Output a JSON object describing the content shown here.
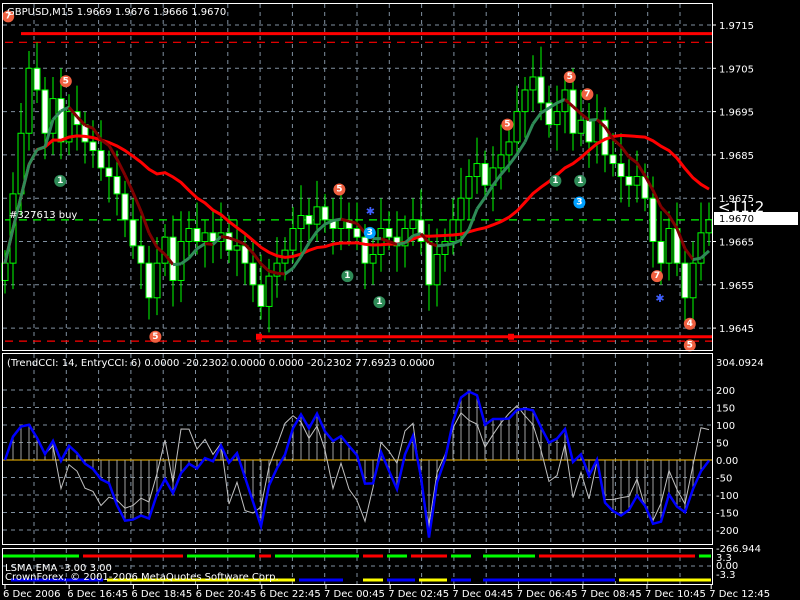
{
  "header": {
    "symbol_info": "GBPUSD,M15  1.9669 1.9676 1.9666 1.9670"
  },
  "main_axis": {
    "ticks": [
      "1.9715",
      "1.9705",
      "1.9695",
      "1.9685",
      "1.9675",
      "1.9665",
      "1.9655",
      "1.9645"
    ],
    "current_price": "1.9670",
    "timer_label": "<11:2"
  },
  "order_label": "#327613 buy",
  "cci_pane": {
    "title": "(TrendCCI: 14, EntryCCI: 6)  0.0000 -20.2302 0.0000 0.0000 -20.2302 77.6923 0.0000",
    "ticks": [
      "304.0924",
      "200",
      "150",
      "100",
      "50",
      "0.00",
      "-50",
      "-100",
      "-150",
      "-200",
      "-266.944"
    ],
    "trend_color": "#0000ff",
    "entry_color": "#c0c0c0"
  },
  "lsma_pane": {
    "title": "LSMA EMA -3.00 3.00",
    "copyright": "CrownForex, © 2001-2006 MetaQuotes Software Corp.",
    "ticks": [
      "3.3",
      "0.00",
      "-3.3"
    ],
    "top_segments": [
      [
        0,
        9,
        "#00ff00"
      ],
      [
        10,
        22,
        "#ff0000"
      ],
      [
        23,
        31,
        "#00ff00"
      ],
      [
        32,
        33,
        "#ff0000"
      ],
      [
        34,
        44,
        "#00ff00"
      ],
      [
        45,
        47,
        "#ff0000"
      ],
      [
        48,
        50,
        "#00ff00"
      ],
      [
        51,
        55,
        "#ff0000"
      ],
      [
        56,
        58,
        "#00ff00"
      ],
      [
        60,
        66,
        "#00ff00"
      ],
      [
        67,
        86,
        "#ff0000"
      ],
      [
        87,
        88,
        "#00ff00"
      ]
    ],
    "bottom_segments": [
      [
        1,
        12,
        "#0000ff"
      ],
      [
        13,
        36,
        "#ffff00"
      ],
      [
        37,
        42,
        "#0000ff"
      ],
      [
        45,
        47,
        "#ffff00"
      ],
      [
        48,
        51,
        "#0000ff"
      ],
      [
        52,
        55,
        "#ffff00"
      ],
      [
        56,
        58,
        "#0000ff"
      ],
      [
        60,
        76,
        "#0000ff"
      ],
      [
        77,
        88,
        "#ffff00"
      ]
    ]
  },
  "time_axis": [
    "6 Dec 2006",
    "6 Dec 16:45",
    "6 Dec 18:45",
    "6 Dec 20:45",
    "6 Dec 22:45",
    "7 Dec 00:45",
    "7 Dec 02:45",
    "7 Dec 04:45",
    "7 Dec 06:45",
    "7 Dec 08:45",
    "7 Dec 10:45",
    "7 Dec 12:45"
  ],
  "chart_data": {
    "type": "candlestick",
    "symbol": "GBPUSD",
    "timeframe": "M15",
    "ylim": [
      1.9638,
      1.9722
    ],
    "closes": [
      1.966,
      1.9676,
      1.969,
      1.9705,
      1.97,
      1.969,
      1.9698,
      1.9688,
      1.9695,
      1.9692,
      1.9688,
      1.9686,
      1.9682,
      1.968,
      1.9676,
      1.967,
      1.9664,
      1.966,
      1.9652,
      1.966,
      1.9666,
      1.9656,
      1.9665,
      1.9668,
      1.9665,
      1.9667,
      1.9665,
      1.9667,
      1.9663,
      1.9664,
      1.966,
      1.9655,
      1.965,
      1.9657,
      1.966,
      1.9663,
      1.9668,
      1.9671,
      1.9669,
      1.9673,
      1.967,
      1.9668,
      1.967,
      1.9668,
      1.9666,
      1.966,
      1.9662,
      1.9668,
      1.9666,
      1.9664,
      1.9668,
      1.967,
      1.9665,
      1.9655,
      1.9662,
      1.9665,
      1.967,
      1.9675,
      1.968,
      1.9683,
      1.9678,
      1.9682,
      1.9685,
      1.9688,
      1.9695,
      1.97,
      1.9703,
      1.9697,
      1.9692,
      1.9695,
      1.97,
      1.969,
      1.9693,
      1.9688,
      1.9693,
      1.9685,
      1.9683,
      1.968,
      1.9678,
      1.968,
      1.9675,
      1.9665,
      1.966,
      1.9668,
      1.966,
      1.9652,
      1.966,
      1.9667,
      1.967
    ],
    "levels": [
      {
        "price": 1.9713,
        "style": "solid",
        "color": "#ff0000",
        "from_bar": 2
      },
      {
        "price": 1.9711,
        "style": "dashed",
        "color": "#ff0000",
        "from_bar": 0
      },
      {
        "price": 1.967,
        "style": "dashed",
        "color": "#00ff00",
        "from_bar": 0
      },
      {
        "price": 1.9643,
        "style": "solid",
        "color": "#ff0000",
        "from_bar": 32
      },
      {
        "price": 1.9642,
        "style": "dashed",
        "color": "#ff0000",
        "from_bar": 0
      }
    ],
    "markers": [
      {
        "bar": 0.4,
        "price": 1.9717,
        "label": "7",
        "color": "#f06040"
      },
      {
        "bar": 7.6,
        "price": 1.9702,
        "label": "5",
        "color": "#f06040"
      },
      {
        "bar": 6.9,
        "price": 1.9679,
        "label": "1",
        "color": "#2e8b57"
      },
      {
        "bar": 18.8,
        "price": 1.9643,
        "label": "5",
        "color": "#f06040"
      },
      {
        "bar": 41.8,
        "price": 1.9677,
        "label": "5",
        "color": "#f06040"
      },
      {
        "bar": 45.6,
        "price": 1.9667,
        "label": "3",
        "color": "#00a0ff"
      },
      {
        "bar": 42.8,
        "price": 1.9657,
        "label": "1",
        "color": "#2e8b57"
      },
      {
        "bar": 46.8,
        "price": 1.9651,
        "label": "1",
        "color": "#2e8b57"
      },
      {
        "bar": 70.6,
        "price": 1.9703,
        "label": "5",
        "color": "#f06040"
      },
      {
        "bar": 62.8,
        "price": 1.9692,
        "label": "5",
        "color": "#f06040"
      },
      {
        "bar": 72.8,
        "price": 1.9699,
        "label": "7",
        "color": "#f06040"
      },
      {
        "bar": 68.8,
        "price": 1.9679,
        "label": "1",
        "color": "#2e8b57"
      },
      {
        "bar": 71.9,
        "price": 1.9679,
        "label": "1",
        "color": "#2e8b57"
      },
      {
        "bar": 71.8,
        "price": 1.9674,
        "label": "3",
        "color": "#00a0ff"
      },
      {
        "bar": 81.5,
        "price": 1.9657,
        "label": "7",
        "color": "#f06040"
      },
      {
        "bar": 85.6,
        "price": 1.9646,
        "label": "4",
        "color": "#f06040"
      },
      {
        "bar": 85.6,
        "price": 1.9641,
        "label": "5",
        "color": "#f06040"
      }
    ],
    "stars": [
      {
        "bar": 45.6,
        "price": 1.9672
      },
      {
        "bar": 81.8,
        "price": 1.9652
      }
    ],
    "cci_ylim": [
      -266.944,
      304.0924
    ]
  }
}
